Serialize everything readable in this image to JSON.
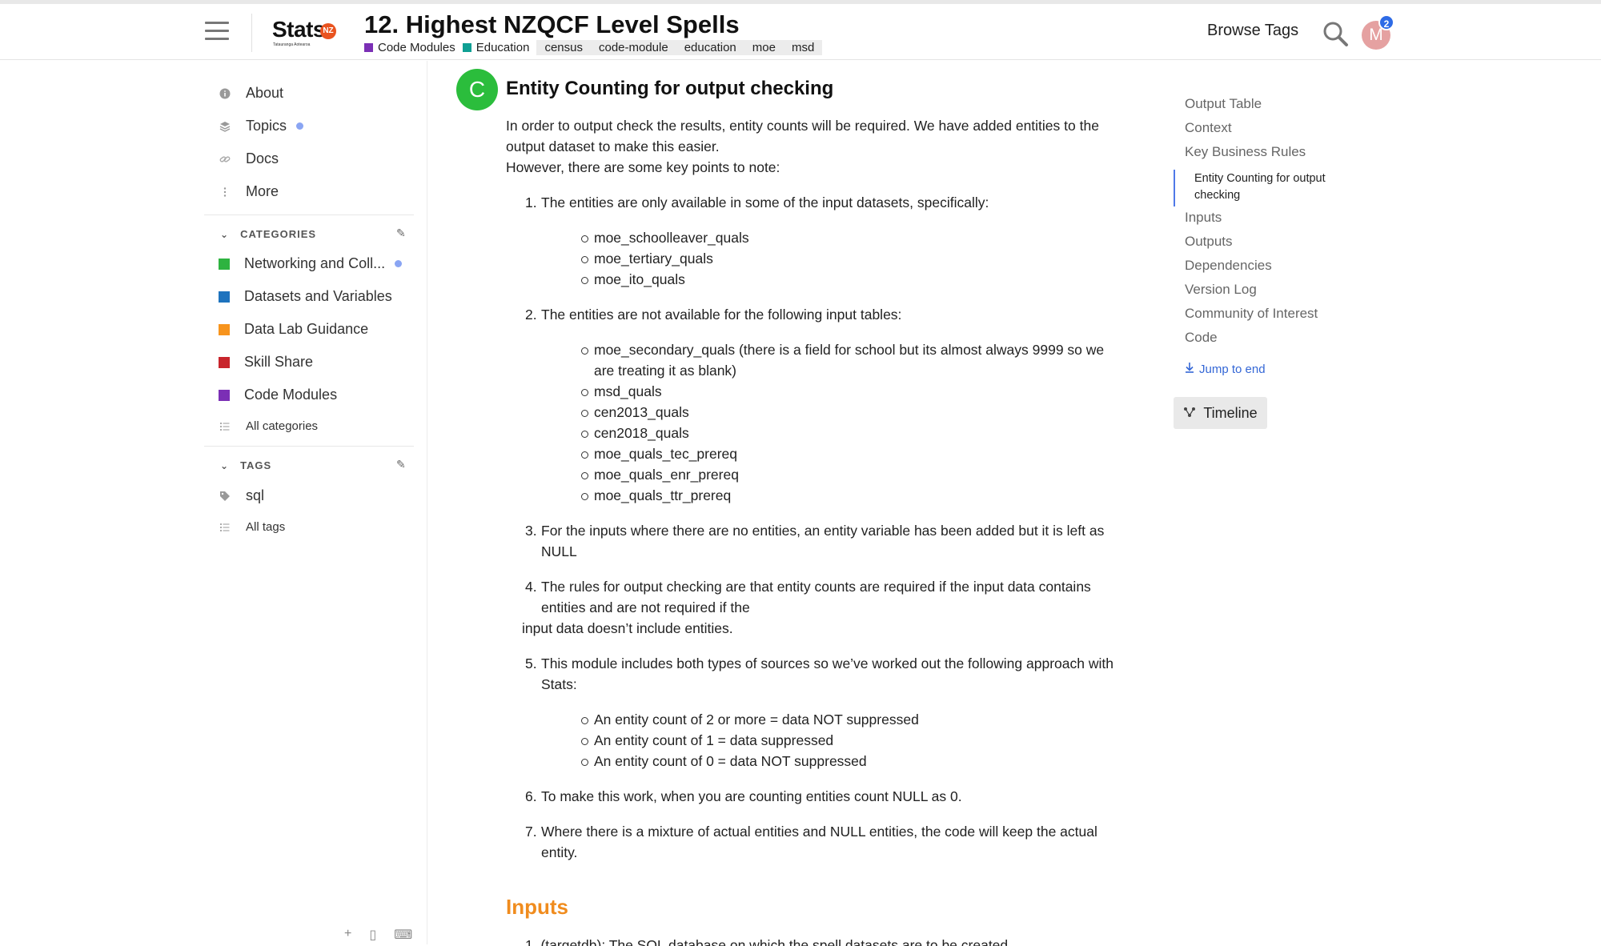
{
  "header": {
    "logo": {
      "text": "Stats",
      "badge": "NZ",
      "sub": "Tatauranga Aotearoa"
    },
    "title": "12. Highest NZQCF Level Spells",
    "categories": [
      {
        "label": "Code Modules",
        "color": "#7b2fb5"
      },
      {
        "label": "Education",
        "color": "#0f9f93"
      }
    ],
    "tags": [
      "census",
      "code-module",
      "education",
      "moe",
      "msd"
    ],
    "browse_label": "Browse Tags",
    "avatar_letter": "M",
    "notification_count": "2"
  },
  "sidebar": {
    "nav": [
      {
        "label": "About",
        "icon": "info-icon"
      },
      {
        "label": "Topics",
        "icon": "layers-icon"
      },
      {
        "label": "Docs",
        "icon": "link-icon"
      },
      {
        "label": "More",
        "icon": "more-vertical-icon"
      }
    ],
    "categories_heading": "CATEGORIES",
    "categories": [
      {
        "label": "Networking and Coll...",
        "color": "#2eb340"
      },
      {
        "label": "Datasets and Variables",
        "color": "#1e73be"
      },
      {
        "label": "Data Lab Guidance",
        "color": "#f7941d"
      },
      {
        "label": "Skill Share",
        "color": "#c8252c"
      },
      {
        "label": "Code Modules",
        "color": "#7b2fb5"
      }
    ],
    "all_categories": "All categories",
    "tags_heading": "TAGS",
    "tags": [
      {
        "label": "sql"
      }
    ],
    "all_tags": "All tags"
  },
  "post": {
    "author_letter": "C",
    "heading": "Entity Counting for output checking",
    "intro_1": "In order to output check the results, entity counts will be required. We have added entities to the output dataset to make this easier.",
    "intro_2": "However, there are some key points to note:",
    "items": [
      {
        "num": "1.",
        "text": "The entities are only available in some of the input datasets, specifically:"
      },
      {
        "num": "2.",
        "text": "The entities are not available for the following input tables:"
      },
      {
        "num": "3.",
        "text": "For the inputs where there are no entities, an entity variable has been added but it is left as NULL"
      },
      {
        "num": "4.",
        "text": "The rules for output checking are that entity counts are required if the input data contains entities and are not required if the"
      },
      {
        "num": "5.",
        "text": "This module includes both types of sources so we’ve worked out the following approach with Stats:"
      },
      {
        "num": "6.",
        "text": "To make this work, when you are counting entities count NULL as 0."
      },
      {
        "num": "7.",
        "text": "Where there is a mixture of actual entities and NULL entities, the code will keep the actual entity."
      }
    ],
    "item4_line2": "input data doesn’t include entities.",
    "list1": [
      "moe_schoolleaver_quals",
      "moe_tertiary_quals",
      "moe_ito_quals"
    ],
    "list2": [
      "moe_secondary_quals (there is a field for school but its almost always 9999 so we are treating it as blank)",
      "msd_quals",
      "cen2013_quals",
      "cen2018_quals",
      "moe_quals_tec_prereq",
      "moe_quals_enr_prereq",
      "moe_quals_ttr_prereq"
    ],
    "list5": [
      "An entity count of 2 or more = data NOT suppressed",
      "An entity count of 1 = data suppressed",
      "An entity count of 0 = data NOT suppressed"
    ],
    "inputs_heading": "Inputs",
    "inputs_first_line": "1. (targetdb): The SQL database on which the spell datasets are to be created"
  },
  "toc": {
    "items": [
      "Output Table",
      "Context",
      "Key Business Rules"
    ],
    "active": "Entity Counting for output checking",
    "items_after": [
      "Inputs",
      "Outputs",
      "Dependencies",
      "Version Log",
      "Community of Interest",
      "Code"
    ],
    "jump_label": "Jump to end",
    "timeline_label": "Timeline"
  }
}
